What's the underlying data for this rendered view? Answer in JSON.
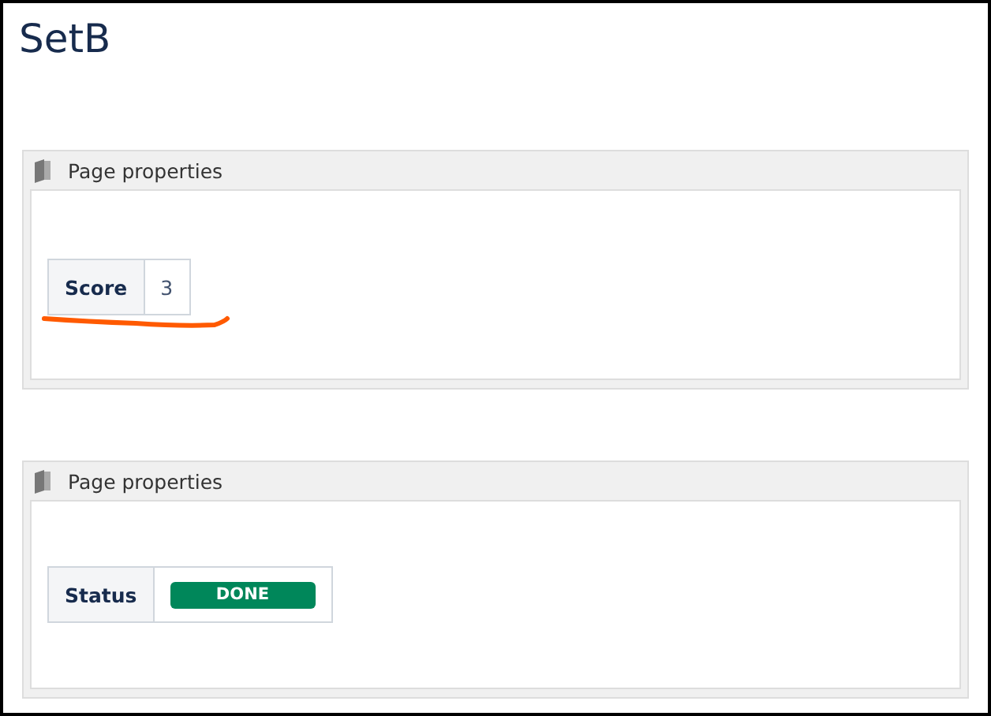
{
  "page_title": "SetB",
  "panels": [
    {
      "title": "Page properties",
      "underlined": true,
      "rows": [
        {
          "label": "Score",
          "kind": "text",
          "value": "3"
        }
      ]
    },
    {
      "title": "Page properties",
      "underlined": false,
      "rows": [
        {
          "label": "Status",
          "kind": "lozenge",
          "value": "DONE"
        }
      ]
    }
  ]
}
